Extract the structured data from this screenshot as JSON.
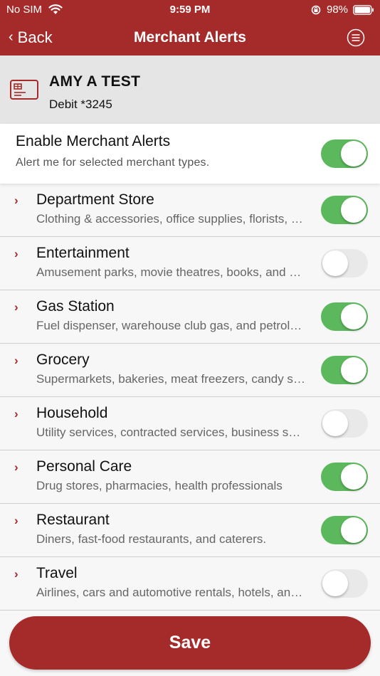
{
  "status_bar": {
    "carrier": "No SIM",
    "time": "9:59 PM",
    "battery": "98%"
  },
  "nav": {
    "back_label": "Back",
    "title": "Merchant Alerts",
    "menu_icon": "menu-icon"
  },
  "account": {
    "name": "AMY A TEST",
    "detail": "Debit *3245",
    "icon": "card-icon"
  },
  "enable": {
    "title": "Enable Merchant Alerts",
    "subtitle": "Alert me for selected merchant types.",
    "on": true
  },
  "merchants": [
    {
      "name": "Department Store",
      "description": "Clothing & accessories, office supplies, florists, and more",
      "on": true
    },
    {
      "name": "Entertainment",
      "description": "Amusement parks, movie theatres, books, and more",
      "on": false
    },
    {
      "name": "Gas Station",
      "description": "Fuel dispenser, warehouse club gas, and petroleum",
      "on": true
    },
    {
      "name": "Grocery",
      "description": "Supermarkets, bakeries, meat freezers, candy stores",
      "on": true
    },
    {
      "name": "Household",
      "description": "Utility services, contracted services, business services",
      "on": false
    },
    {
      "name": "Personal Care",
      "description": "Drug stores, pharmacies, health professionals",
      "on": true
    },
    {
      "name": "Restaurant",
      "description": "Diners, fast-food restaurants, and caterers.",
      "on": true
    },
    {
      "name": "Travel",
      "description": "Airlines, cars and automotive rentals, hotels, and more",
      "on": false
    }
  ],
  "save_label": "Save",
  "colors": {
    "brand": "#a52a2a",
    "toggle_on": "#5cb85c",
    "toggle_off": "#e9e9ea"
  }
}
